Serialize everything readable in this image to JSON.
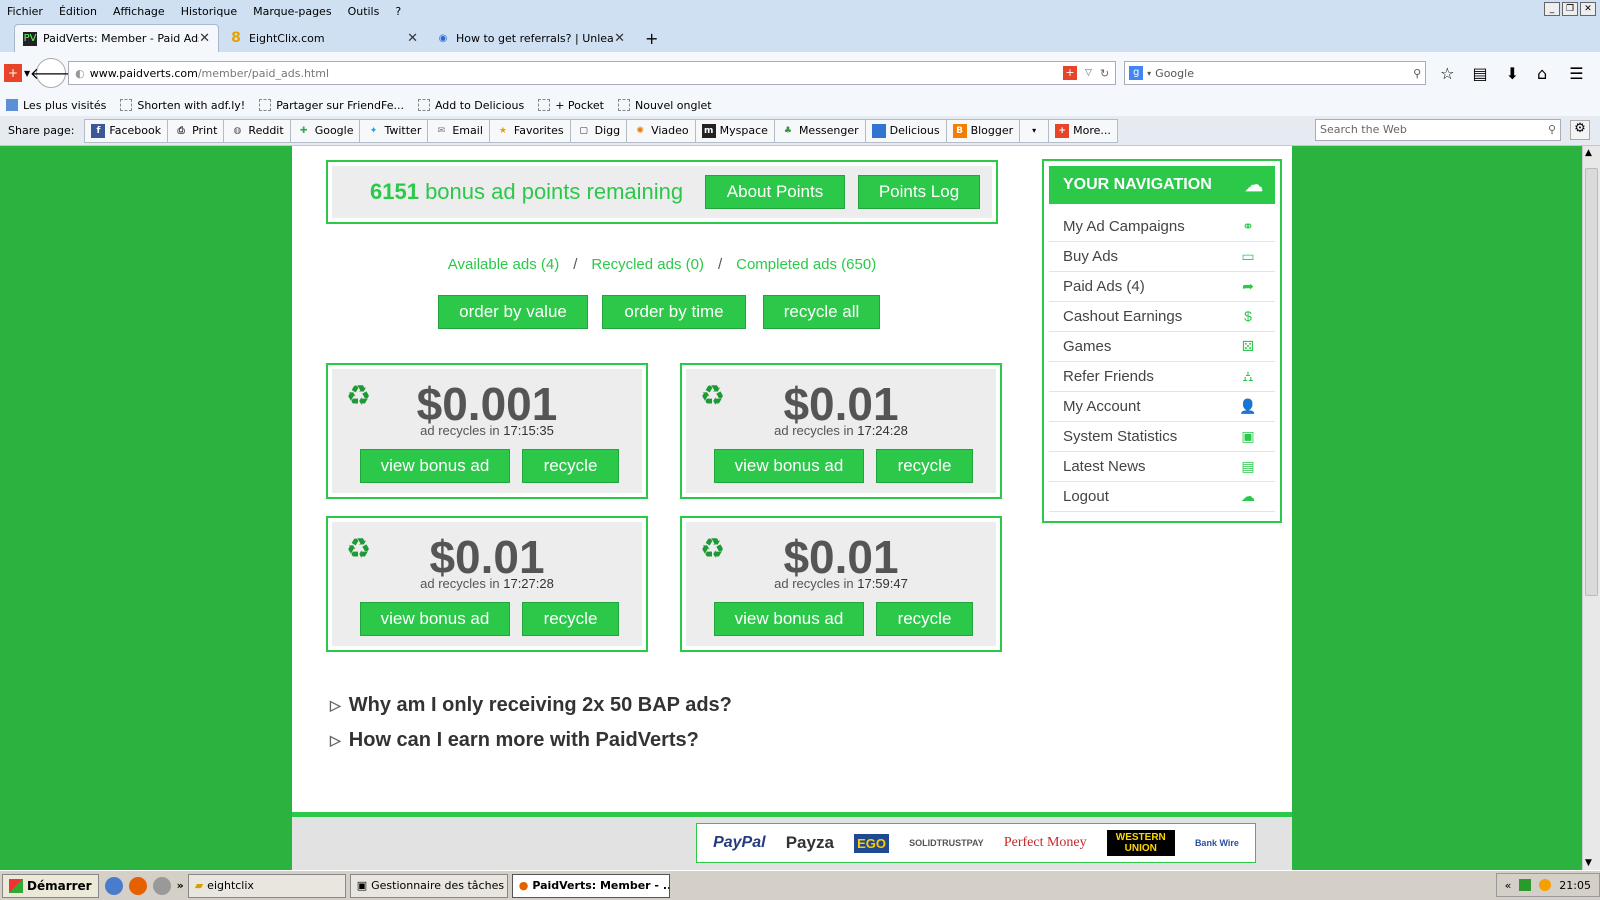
{
  "menubar": {
    "items": [
      "Fichier",
      "Édition",
      "Affichage",
      "Historique",
      "Marque-pages",
      "Outils",
      "?"
    ]
  },
  "tabs": [
    {
      "title": "PaidVerts: Member - Paid Ads",
      "favicon": "PV",
      "active": true
    },
    {
      "title": "EightClix.com",
      "favicon": "8",
      "active": false
    },
    {
      "title": "How to get referrals? | Unlea...",
      "favicon": "",
      "active": false
    }
  ],
  "newtab_label": "+",
  "address": {
    "host": "www.paidverts.com",
    "path": "/member/paid_ads.html"
  },
  "search": {
    "placeholder": "Google"
  },
  "bookmarks": [
    "Les plus visités",
    "Shorten with adf.ly!",
    "Partager sur FriendFe...",
    "Add to Delicious",
    "+ Pocket",
    "Nouvel onglet"
  ],
  "sharebar": {
    "label": "Share page:",
    "items": [
      "Facebook",
      "Print",
      "Reddit",
      "Google",
      "Twitter",
      "Email",
      "Favorites",
      "Digg",
      "Viadeo",
      "Myspace",
      "Messenger",
      "Delicious",
      "Blogger",
      "",
      "More..."
    ],
    "search_placeholder": "Search the Web"
  },
  "points": {
    "count": "6151",
    "text": " bonus ad points remaining",
    "about_btn": "About Points",
    "log_btn": "Points Log"
  },
  "filters": {
    "available": "Available ads (4)",
    "recycled": "Recycled ads (0)",
    "completed": "Completed ads (650)",
    "sep": "/"
  },
  "order": {
    "by_value": "order by value",
    "by_time": "order by time",
    "recycle_all": "recycle all"
  },
  "ads": [
    {
      "price": "$0.001",
      "label": "ad recycles in ",
      "time": "17:15:35",
      "view": "view bonus ad",
      "recycle": "recycle"
    },
    {
      "price": "$0.01",
      "label": "ad recycles in ",
      "time": "17:24:28",
      "view": "view bonus ad",
      "recycle": "recycle"
    },
    {
      "price": "$0.01",
      "label": "ad recycles in ",
      "time": "17:27:28",
      "view": "view bonus ad",
      "recycle": "recycle"
    },
    {
      "price": "$0.01",
      "label": "ad recycles in ",
      "time": "17:59:47",
      "view": "view bonus ad",
      "recycle": "recycle"
    }
  ],
  "faq": [
    "Why am I only receiving 2x 50 BAP ads?",
    "How can I earn more with PaidVerts?"
  ],
  "navigation": {
    "title": "YOUR NAVIGATION",
    "items": [
      "My Ad Campaigns",
      "Buy Ads",
      "Paid Ads (4)",
      "Cashout Earnings",
      "Games",
      "Refer Friends",
      "My Account",
      "System Statistics",
      "Latest News",
      "Logout"
    ]
  },
  "payments": [
    "PayPal",
    "Payza",
    "EGO",
    "SOLIDTRUSTPAY",
    "Perfect Money",
    "WESTERN UNION",
    "Bank Wire"
  ],
  "taskbar": {
    "start": "Démarrer",
    "tasks": [
      "eightclix",
      "Gestionnaire des tâches ...",
      "PaidVerts: Member - ..."
    ],
    "clock": "21:05"
  }
}
